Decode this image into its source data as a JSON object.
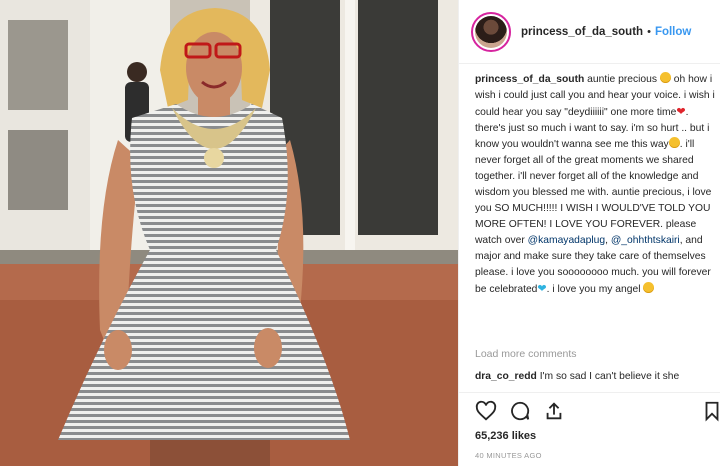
{
  "photo": {
    "description_icon": "photo-woman-striped-dress"
  },
  "post": {
    "username": "princess_of_da_south",
    "separator": "•",
    "follow_label": "Follow",
    "caption": {
      "username": "princess_of_da_south",
      "p1": "auntie precious",
      "p2": "oh how i wish i could just call you and hear your voice. i wish i could hear you say \"deydiiiiii\" one more time",
      "p3": ". there's just so much i want to say. i'm so hurt .. but i know you wouldn't wanna see me this way",
      "p4": ". i'll never forget all of the great moments we shared together. i'll never forget all of the knowledge and wisdom you blessed me with. auntie precious, i love you SO MUCH!!!!! I WISH I WOULD'VE TOLD YOU MORE OFTEN! I LOVE YOU FOREVER. please watch over",
      "mention1": "@kamayadaplug",
      "p5": ",",
      "mention2": "@_ohhthtskairi",
      "p6": ", and major and make sure they take care of themselves please. i love you soooooooo much. you will forever be celebrated",
      "p7": ". i love you my angel"
    },
    "load_more": "Load more comments",
    "comment": {
      "username": "dra_co_redd",
      "text": "I'm so sad I can't believe it she"
    },
    "likes": "65,236 likes",
    "time": "40 MINUTES AGO"
  },
  "colors": {
    "link": "#3897f0",
    "mention": "#003569",
    "muted": "#999999"
  }
}
